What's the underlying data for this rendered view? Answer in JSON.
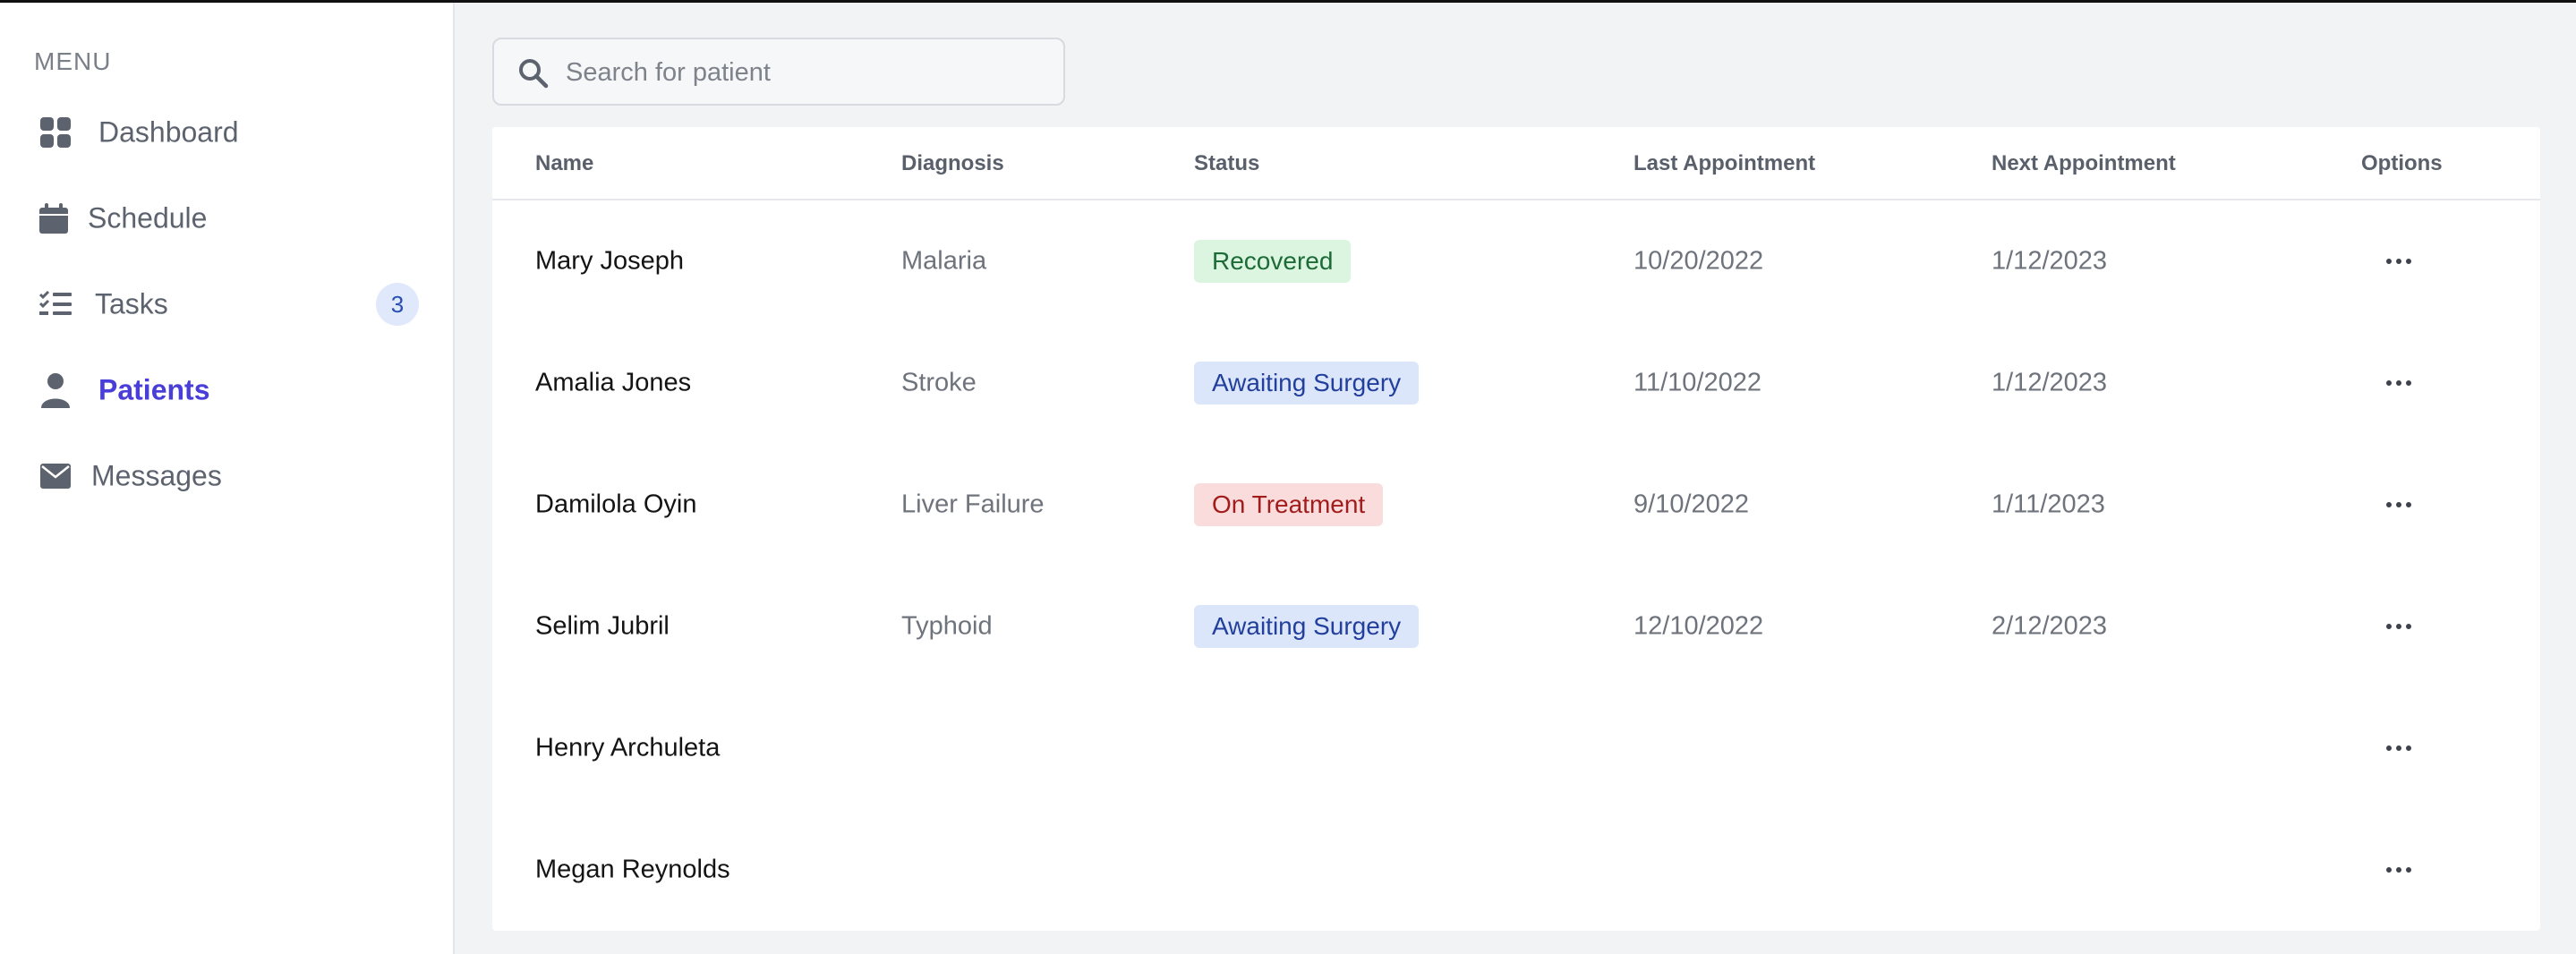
{
  "colors": {
    "accent": "#4a3ed8",
    "recovered_bg": "#dcf5e1",
    "recovered_text": "#1d6b37",
    "awaiting_bg": "#dbe6fb",
    "awaiting_text": "#233f9c",
    "treatment_bg": "#fbdcdc",
    "treatment_text": "#a11c1c"
  },
  "sidebar": {
    "menu_label": "MENU",
    "items": [
      {
        "label": "Dashboard",
        "icon": "grid-icon"
      },
      {
        "label": "Schedule",
        "icon": "calendar-icon"
      },
      {
        "label": "Tasks",
        "icon": "checklist-icon",
        "badge": "3"
      },
      {
        "label": "Patients",
        "icon": "person-icon",
        "active": true
      },
      {
        "label": "Messages",
        "icon": "envelope-icon"
      }
    ]
  },
  "search": {
    "placeholder": "Search for patient",
    "icon": "search-icon"
  },
  "table": {
    "headers": {
      "name": "Name",
      "diagnosis": "Diagnosis",
      "status": "Status",
      "last_appointment": "Last Appointment",
      "next_appointment": "Next Appointment",
      "options": "Options"
    },
    "rows": [
      {
        "name": "Mary Joseph",
        "diagnosis": "Malaria",
        "status": "Recovered",
        "last": "10/20/2022",
        "next": "1/12/2023"
      },
      {
        "name": "Amalia Jones",
        "diagnosis": "Stroke",
        "status": "Awaiting Surgery",
        "last": "11/10/2022",
        "next": "1/12/2023"
      },
      {
        "name": "Damilola Oyin",
        "diagnosis": "Liver Failure",
        "status": "On Treatment",
        "last": "9/10/2022",
        "next": "1/11/2023"
      },
      {
        "name": "Selim Jubril",
        "diagnosis": "Typhoid",
        "status": "Awaiting Surgery",
        "last": "12/10/2022",
        "next": "2/12/2023"
      },
      {
        "name": "Henry Archuleta",
        "diagnosis": "",
        "status": "",
        "last": "",
        "next": ""
      },
      {
        "name": "Megan Reynolds",
        "diagnosis": "",
        "status": "",
        "last": "",
        "next": ""
      }
    ]
  }
}
